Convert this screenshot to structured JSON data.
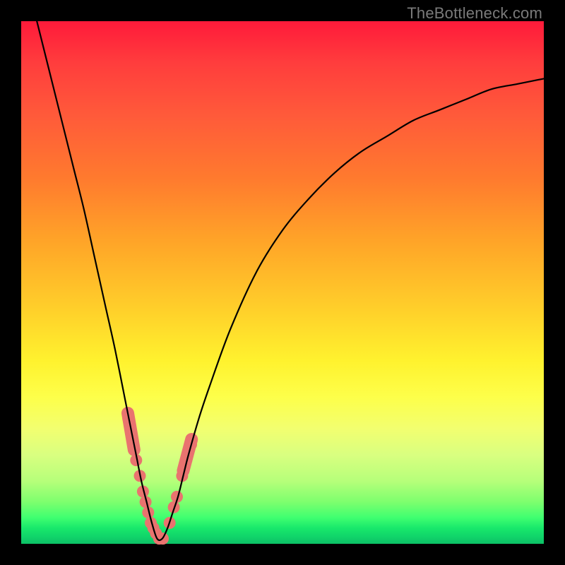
{
  "watermark": "TheBottleneck.com",
  "colors": {
    "frame": "#000000",
    "curve": "#000000",
    "marker": "#e9736f"
  },
  "chart_data": {
    "type": "line",
    "title": "",
    "xlabel": "",
    "ylabel": "",
    "xlim": [
      0,
      100
    ],
    "ylim": [
      0,
      100
    ],
    "grid": false,
    "legend": false,
    "note": "V-shaped bottleneck curve; y is mismatch %, minimum near x≈26. Values estimated from pixels.",
    "series": [
      {
        "name": "bottleneck-curve",
        "x": [
          3,
          5,
          8,
          10,
          12,
          14,
          16,
          18,
          20,
          21,
          22,
          23,
          24,
          25,
          26,
          27,
          28,
          29,
          30,
          31,
          32,
          34,
          36,
          40,
          45,
          50,
          55,
          60,
          65,
          70,
          75,
          80,
          85,
          90,
          95,
          100
        ],
        "y": [
          100,
          92,
          80,
          72,
          64,
          55,
          46,
          37,
          27,
          22,
          17,
          12,
          8,
          4,
          1,
          1,
          3,
          6,
          9,
          13,
          17,
          24,
          30,
          41,
          52,
          60,
          66,
          71,
          75,
          78,
          81,
          83,
          85,
          87,
          88,
          89
        ]
      }
    ],
    "markers": {
      "name": "highlighted-points",
      "note": "Salmon rounded markers clustered near the valley on both branches.",
      "x": [
        20.5,
        21.3,
        22.0,
        22.7,
        23.3,
        23.8,
        24.3,
        24.8,
        25.3,
        25.8,
        26.4,
        27.1,
        28.4,
        29.2,
        29.8,
        30.8,
        31.6,
        32.5
      ],
      "y": [
        24,
        20,
        16,
        13,
        10,
        8,
        6,
        4,
        3,
        2,
        1,
        1,
        4,
        7,
        9,
        13,
        16,
        19
      ]
    }
  }
}
